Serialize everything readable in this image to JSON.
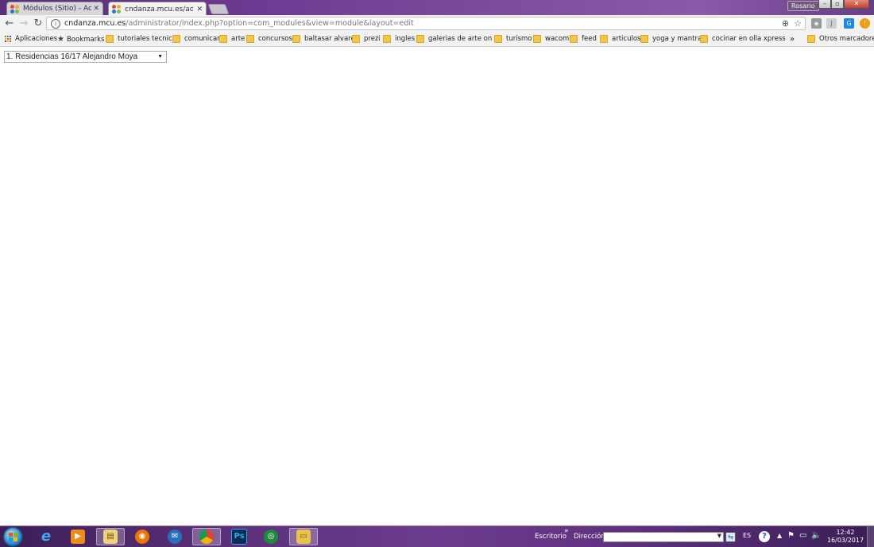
{
  "browser": {
    "tabs": [
      {
        "title": "Módulos (Sitio) - Actualiz",
        "active": false
      },
      {
        "title": "cndanza.mcu.es/administ",
        "active": true
      }
    ],
    "profile_label": "Rosario",
    "address": {
      "host": "cndanza.mcu.es",
      "path": "/administrator/index.php?option=com_modules&view=module&layout=edit"
    },
    "bookmarks": [
      {
        "label": "Aplicaciones",
        "icon": "apps-grid-icon"
      },
      {
        "label": "Bookmarks",
        "icon": "star-icon"
      },
      {
        "label": "tutoriales tecnicos",
        "icon": "folder-icon"
      },
      {
        "label": "comunicar",
        "icon": "folder-icon"
      },
      {
        "label": "arte",
        "icon": "folder-icon"
      },
      {
        "label": "concursos",
        "icon": "folder-icon"
      },
      {
        "label": "baltasar alvarez",
        "icon": "folder-icon"
      },
      {
        "label": "prezi",
        "icon": "folder-icon"
      },
      {
        "label": "ingles",
        "icon": "folder-icon"
      },
      {
        "label": "galerias de arte on lin",
        "icon": "folder-icon"
      },
      {
        "label": "turismo",
        "icon": "folder-icon"
      },
      {
        "label": "wacom",
        "icon": "folder-icon"
      },
      {
        "label": "feed",
        "icon": "folder-icon"
      },
      {
        "label": "articulos",
        "icon": "folder-icon"
      },
      {
        "label": "yoga y mantras",
        "icon": "folder-icon"
      },
      {
        "label": "cocinar en olla xpress",
        "icon": "folder-icon"
      }
    ],
    "overflow_label": "»",
    "other_bookmarks": "Otros marcadores"
  },
  "page": {
    "select_value": "1. Residencias 16/17 Alejandro Moya"
  },
  "taskbar": {
    "toolbar_desktop": "Escritorio",
    "toolbar_chevron": "»",
    "address_label": "Dirección",
    "language": "ES",
    "time": "12:42",
    "date": "16/03/2017",
    "apps": [
      "explorer",
      "internet-explorer",
      "media-player",
      "file-manager",
      "blender",
      "thunderbird",
      "chrome",
      "photoshop",
      "green-app",
      "folder"
    ]
  },
  "colors": {
    "titlebar_accent": "#6f3a92",
    "taskbar_accent": "#5a3078",
    "folder": "#f3c64e"
  }
}
